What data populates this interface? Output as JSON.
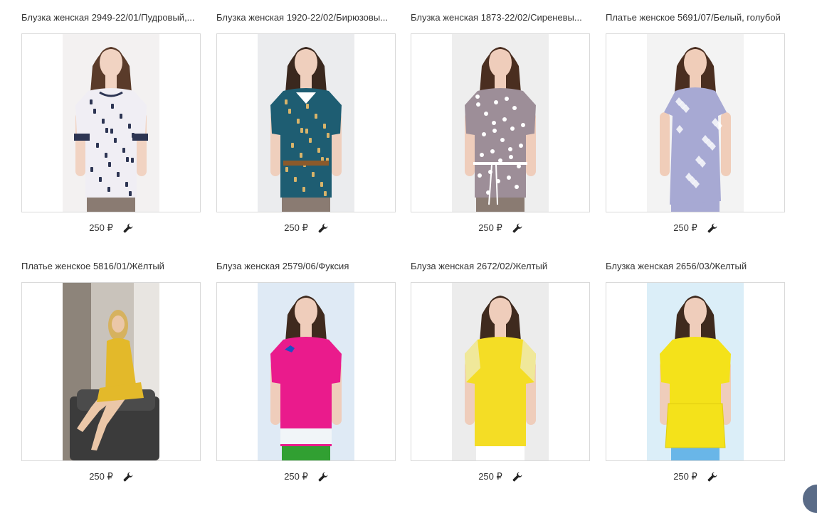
{
  "products": [
    {
      "title": "Блузка женская 2949-22/01/Пудровый,...",
      "price": "250 ₽",
      "photo": {
        "bg": "#f3f1f1",
        "garment": "#f0eef4",
        "pattern": "#2d3553",
        "pants": "#8a7b72",
        "hair": "#5a3b2a",
        "skin": "#f1d3c2",
        "style": "blouse-print"
      }
    },
    {
      "title": "Блузка женская 1920-22/02/Бирюзовы...",
      "price": "250 ₽",
      "photo": {
        "bg": "#ebecee",
        "garment": "#1e5d72",
        "pattern": "#d9b46a",
        "pants": "#8a7b72",
        "hair": "#3a281e",
        "skin": "#efcfbd",
        "style": "blouse-collar"
      }
    },
    {
      "title": "Блузка женская 1873-22/02/Сиреневы...",
      "price": "250 ₽",
      "photo": {
        "bg": "#eeeeee",
        "garment": "#9d8e98",
        "pattern": "#ffffff",
        "pants": "#8a7b72",
        "hair": "#4a2e20",
        "skin": "#efcdbb",
        "style": "blouse-dots"
      }
    },
    {
      "title": "Платье женское 5691/07/Белый, голубой",
      "price": "250 ₽",
      "photo": {
        "bg": "#f3f3f3",
        "garment": "#a7a9d3",
        "pattern": "#ffffff",
        "pants": "#a7a9d3",
        "hair": "#4a2e20",
        "skin": "#f0cdb9",
        "style": "dress"
      }
    },
    {
      "title": "Платье женское 5816/01/Жёлтый",
      "price": "250 ₽",
      "photo": {
        "bg": "#b8b2aa",
        "garment": "#e3b92a",
        "pattern": "#e3b92a",
        "pants": "#e3b92a",
        "hair": "#d6b25f",
        "skin": "#ebc7a8",
        "style": "seated"
      }
    },
    {
      "title": "Блуза женская 2579/06/Фуксия",
      "price": "250 ₽",
      "photo": {
        "bg": "#dfeaf5",
        "garment": "#ea1b8c",
        "pattern": "#ea1b8c",
        "pants": "#31a032",
        "hair": "#3f2a1e",
        "skin": "#efcdbb",
        "style": "blouse-plain"
      }
    },
    {
      "title": "Блуза женская 2672/02/Желтый",
      "price": "250 ₽",
      "photo": {
        "bg": "#ececec",
        "garment": "#f4dd25",
        "pattern": "#f0e89a",
        "pants": "#ffffff",
        "hair": "#3f2a1e",
        "skin": "#efcdbb",
        "style": "blouse-plain"
      }
    },
    {
      "title": "Блузка женская 2656/03/Желтый",
      "price": "250 ₽",
      "photo": {
        "bg": "#dbeef8",
        "garment": "#f4e21a",
        "pattern": "#f4e21a",
        "pants": "#69b6e8",
        "hair": "#3f2a1e",
        "skin": "#efcdbb",
        "style": "blouse-peplum"
      }
    }
  ],
  "icons": {
    "action": "wrench-icon"
  },
  "colors": {
    "border": "#d9d9d9",
    "text": "#333333"
  }
}
